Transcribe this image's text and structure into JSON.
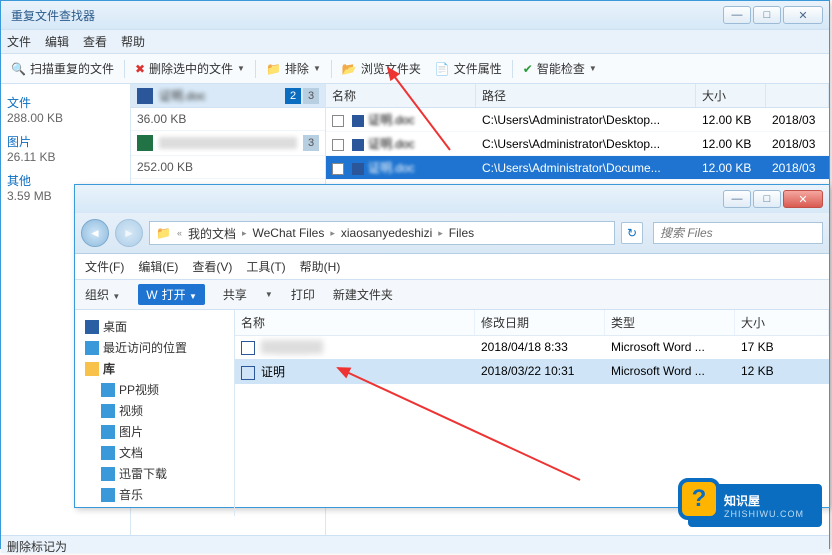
{
  "dupWin": {
    "title": "重复文件查找器",
    "menu": [
      "文件",
      "编辑",
      "查看",
      "帮助"
    ],
    "toolbar": {
      "scan": "扫描重复的文件",
      "del": "删除选中的文件",
      "exclude": "排除",
      "browse": "浏览文件夹",
      "props": "文件属性",
      "smart": "智能检查"
    },
    "side": {
      "cat1": "文件",
      "v1": "288.00 KB",
      "cat2": "图片",
      "v2": "26.11 KB",
      "cat3": "其他",
      "v3": "3.59 MB"
    },
    "mid": {
      "group1": {
        "name": "证明.doc",
        "size": "36.00 KB",
        "n1": "2",
        "n2": "3"
      },
      "group2": {
        "name": "",
        "size": "252.00 KB",
        "n1": "3"
      }
    },
    "cols": {
      "name": "名称",
      "path": "路径",
      "size": "大小"
    },
    "rows": [
      {
        "checked": false,
        "name": "证明.doc",
        "path": "C:\\Users\\Administrator\\Desktop...",
        "size": "12.00 KB",
        "date": "2018/03"
      },
      {
        "checked": false,
        "name": "证明.doc",
        "path": "C:\\Users\\Administrator\\Desktop...",
        "size": "12.00 KB",
        "date": "2018/03"
      },
      {
        "checked": true,
        "name": "证明.doc",
        "path": "C:\\Users\\Administrator\\Docume...",
        "size": "12.00 KB",
        "date": "2018/03"
      }
    ],
    "status": "删除标记为"
  },
  "exp": {
    "crumbs": [
      "我的文档",
      "WeChat Files",
      "xiaosanyedeshizi",
      "Files"
    ],
    "searchPlaceholder": "搜索 Files",
    "menu": [
      "文件(F)",
      "编辑(E)",
      "查看(V)",
      "工具(T)",
      "帮助(H)"
    ],
    "toolbar": {
      "org": "组织",
      "open": "打开",
      "share": "共享",
      "print": "打印",
      "newf": "新建文件夹"
    },
    "tree": [
      {
        "label": "桌面",
        "icon": "#2b5fa4"
      },
      {
        "label": "最近访问的位置",
        "icon": "#3a9ad9"
      },
      {
        "label": "库",
        "icon": "#f7c14a",
        "bold": true
      },
      {
        "label": "PP视频",
        "icon": "#3a9ad9",
        "l2": true
      },
      {
        "label": "视频",
        "icon": "#3a9ad9",
        "l2": true
      },
      {
        "label": "图片",
        "icon": "#3a9ad9",
        "l2": true
      },
      {
        "label": "文档",
        "icon": "#3a9ad9",
        "l2": true
      },
      {
        "label": "迅雷下载",
        "icon": "#3a9ad9",
        "l2": true
      },
      {
        "label": "音乐",
        "icon": "#3a9ad9",
        "l2": true
      }
    ],
    "fcols": {
      "name": "名称",
      "date": "修改日期",
      "type": "类型",
      "size": "大小"
    },
    "frows": [
      {
        "name": "████",
        "date": "2018/04/18 8:33",
        "type": "Microsoft Word ...",
        "size": "17 KB",
        "sel": false,
        "blur": true
      },
      {
        "name": "证明",
        "date": "2018/03/22 10:31",
        "type": "Microsoft Word ...",
        "size": "12 KB",
        "sel": true,
        "blur": false
      }
    ]
  },
  "logo": {
    "main": "知识屋",
    "sub": "ZHISHIWU.COM"
  }
}
